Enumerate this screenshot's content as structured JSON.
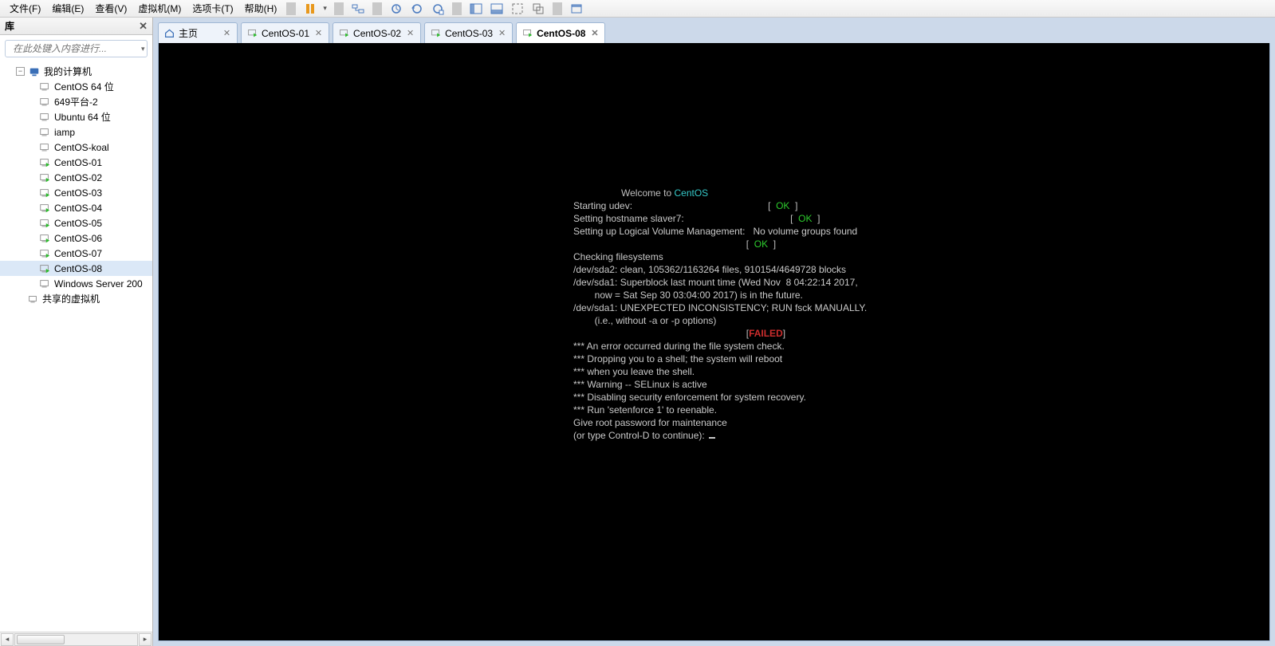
{
  "menu": {
    "items": [
      "文件(F)",
      "编辑(E)",
      "查看(V)",
      "虚拟机(M)",
      "选项卡(T)",
      "帮助(H)"
    ]
  },
  "sidebar": {
    "title": "库",
    "search_placeholder": "在此处键入内容进行...",
    "root_label": "我的计算机",
    "vms": [
      {
        "label": "CentOS 64 位",
        "state": "off"
      },
      {
        "label": "649平台-2",
        "state": "off"
      },
      {
        "label": "Ubuntu 64 位",
        "state": "off"
      },
      {
        "label": "iamp",
        "state": "off"
      },
      {
        "label": "CentOS-koal",
        "state": "off"
      },
      {
        "label": "CentOS-01",
        "state": "on"
      },
      {
        "label": "CentOS-02",
        "state": "on"
      },
      {
        "label": "CentOS-03",
        "state": "on"
      },
      {
        "label": "CentOS-04",
        "state": "on"
      },
      {
        "label": "CentOS-05",
        "state": "on"
      },
      {
        "label": "CentOS-06",
        "state": "on"
      },
      {
        "label": "CentOS-07",
        "state": "on"
      },
      {
        "label": "CentOS-08",
        "state": "on",
        "selected": true
      },
      {
        "label": "Windows Server 200",
        "state": "off"
      }
    ],
    "shared_label": "共享的虚拟机"
  },
  "tabs": [
    {
      "label": "主页",
      "home": true
    },
    {
      "label": "CentOS-01"
    },
    {
      "label": "CentOS-02"
    },
    {
      "label": "CentOS-03"
    },
    {
      "label": "CentOS-08",
      "active": true
    }
  ],
  "console": {
    "welcome_prefix": "Welcome to ",
    "brand": "CentOS",
    "lines_ok": [
      {
        "text": "Starting udev:",
        "status": "OK"
      },
      {
        "text": "Setting hostname slaver7:",
        "status": "OK"
      },
      {
        "text": "Setting up Logical Volume Management:   No volume groups found",
        "status": ""
      },
      {
        "text": "",
        "status": "OK"
      }
    ],
    "body": [
      "Checking filesystems",
      "/dev/sda2: clean, 105362/1163264 files, 910154/4649728 blocks",
      "/dev/sda1: Superblock last mount time (Wed Nov  8 04:22:14 2017,",
      "        now = Sat Sep 30 03:04:00 2017) is in the future.",
      "",
      "",
      "/dev/sda1: UNEXPECTED INCONSISTENCY; RUN fsck MANUALLY.",
      "        (i.e., without -a or -p options)"
    ],
    "failed": "FAILED",
    "tail": [
      "",
      "*** An error occurred during the file system check.",
      "*** Dropping you to a shell; the system will reboot",
      "*** when you leave the shell.",
      "*** Warning -- SELinux is active",
      "*** Disabling security enforcement for system recovery.",
      "*** Run 'setenforce 1' to reenable.",
      "Give root password for maintenance",
      "(or type Control-D to continue): "
    ]
  }
}
